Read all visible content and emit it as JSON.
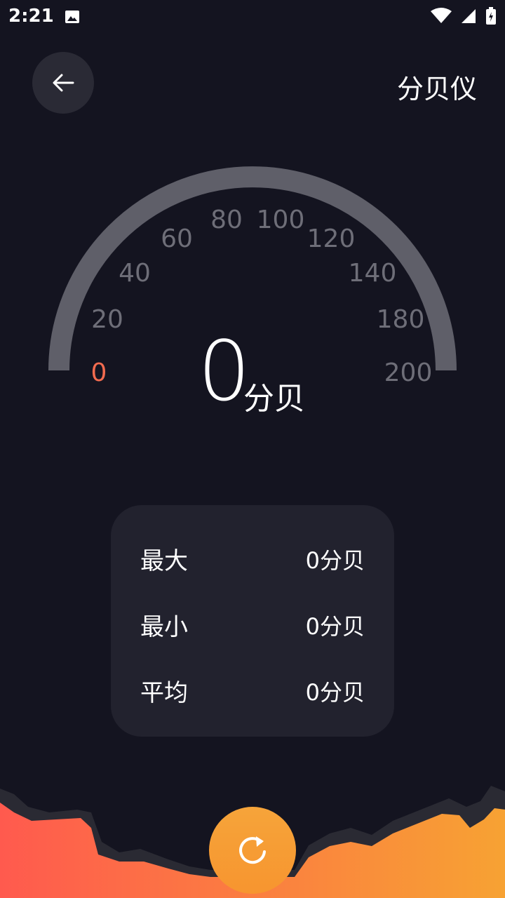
{
  "status_bar": {
    "time": "2:21"
  },
  "header": {
    "title": "分贝仪"
  },
  "gauge": {
    "ticks": [
      "0",
      "20",
      "40",
      "60",
      "80",
      "100",
      "120",
      "140",
      "180",
      "200"
    ],
    "value": "0",
    "unit": "分贝",
    "colors": {
      "track": "#5f5f69",
      "tick": "#6e6e78",
      "active_tick": "#f26b4f"
    }
  },
  "stats": [
    {
      "label": "最大",
      "value": "0分贝"
    },
    {
      "label": "最小",
      "value": "0分贝"
    },
    {
      "label": "平均",
      "value": "0分贝"
    }
  ],
  "colors": {
    "background": "#141420",
    "card": "#22222e",
    "accent": "#f7952f",
    "wave_start": "#ff5a4e",
    "wave_end": "#f7a233"
  }
}
